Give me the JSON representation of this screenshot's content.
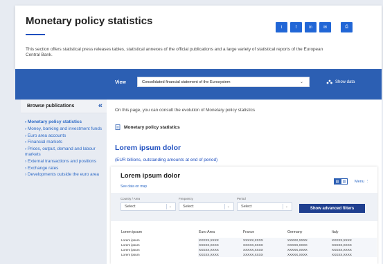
{
  "header": {
    "title": "Monetary policy statistics",
    "intro": "This section offers statistical press releases tables, statistical annexes of the official publications and a large variety of statistical reports of the European Central Bank.",
    "share": [
      {
        "icon": "twitter-icon",
        "glyph": "t"
      },
      {
        "icon": "facebook-icon",
        "glyph": "f"
      },
      {
        "icon": "linkedin-icon",
        "glyph": "in"
      },
      {
        "icon": "email-icon",
        "glyph": "✉"
      },
      {
        "icon": "print-icon",
        "glyph": "⎙"
      }
    ]
  },
  "toolbar": {
    "view_label": "View",
    "view_value": "Consolidated financial statement of the Eurosystem",
    "show_data": "Show data"
  },
  "sidebar": {
    "title": "Browse publications",
    "items": [
      {
        "label": "Monetary policy statistics",
        "active": true
      },
      {
        "label": "Money, banking and investment funds"
      },
      {
        "label": "Euro area accounts"
      },
      {
        "label": "Financial markets"
      },
      {
        "label": "Prices, output, demand and labour markets"
      },
      {
        "label": "External transactions and positions"
      },
      {
        "label": "Exchange rates"
      },
      {
        "label": "Developments outside the euro area"
      }
    ]
  },
  "main": {
    "intro": "On this page, you can consult the evolution of Monetary policy statistics",
    "doc_link": "Monetary policy statistics",
    "section_title": "Lorem ipsum dolor",
    "section_subtitle": "(EUR billions, outstanding amounts at end of period)",
    "card": {
      "title": "Lorem ipsum dolor",
      "map_link": "See data on map",
      "menu": "Menu ⋮",
      "filters": [
        {
          "label": "Country / Area",
          "value": "Select"
        },
        {
          "label": "Frequency",
          "value": "Select"
        },
        {
          "label": "Period",
          "value": "Select"
        }
      ],
      "advanced_filters": "Show advanced filters",
      "table": {
        "columns": [
          "Lorem ipsum",
          "Euro Area",
          "France",
          "Germany",
          "Italy"
        ],
        "rows": [
          [
            "Lorem ipsum",
            "XXXXX,XXXX",
            "XXXXX,XXXX",
            "XXXXX,XXXX",
            "XXXXX,XXXX"
          ],
          [
            "Lorem ipsum",
            "XXXXX,XXXX",
            "XXXXX,XXXX",
            "XXXXX,XXXX",
            "XXXXX,XXXX"
          ],
          [
            "Lorem ipsum",
            "XXXXX,XXXX",
            "XXXXX,XXXX",
            "XXXXX,XXXX",
            "XXXXX,XXXX"
          ],
          [
            "Lorem ipsum",
            "XXXXX,XXXX",
            "XXXXX,XXXX",
            "XXXXX,XXXX",
            "XXXXX,XXXX"
          ]
        ]
      }
    }
  },
  "colors": {
    "accent": "#2c5fb3",
    "link": "#2c69c6",
    "dark_button": "#1f3f8f"
  }
}
